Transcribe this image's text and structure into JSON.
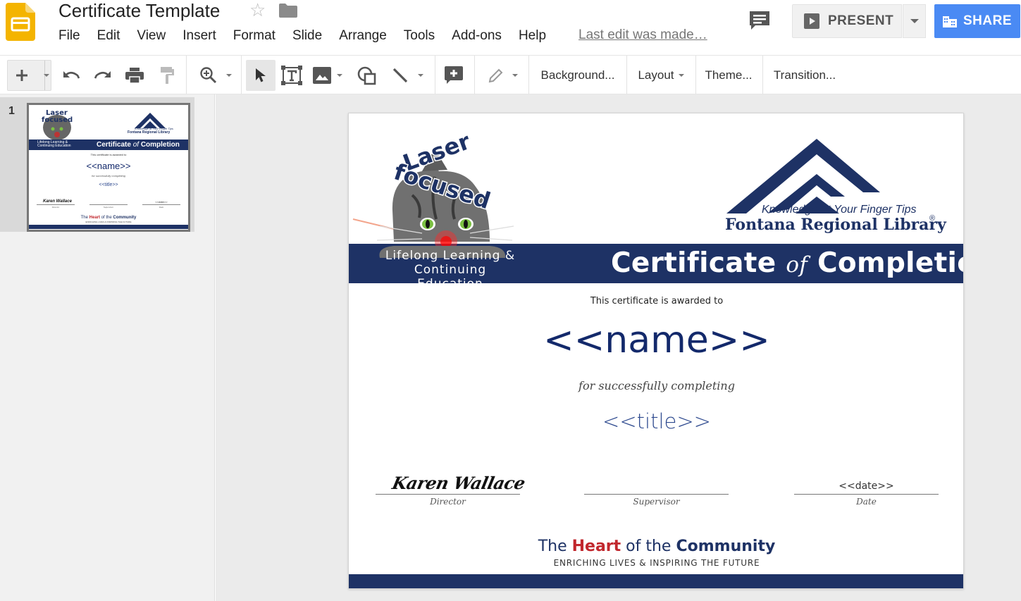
{
  "app": {
    "doc_title": "Certificate Template",
    "menu": [
      "File",
      "Edit",
      "View",
      "Insert",
      "Format",
      "Slide",
      "Arrange",
      "Tools",
      "Add-ons",
      "Help"
    ],
    "last_edit": "Last edit was made…",
    "present_label": "PRESENT",
    "share_label": "SHARE",
    "colors": {
      "share_blue": "#4a8af4",
      "logo_yellow": "#f4b400",
      "navy": "#1e3265"
    }
  },
  "toolbar": {
    "icons": [
      "new-slide-icon",
      "undo-icon",
      "redo-icon",
      "print-icon",
      "paint-format-icon",
      "zoom-icon",
      "select-icon",
      "textbox-icon",
      "image-icon",
      "shape-icon",
      "line-icon",
      "add-comment-icon",
      "pencil-icon"
    ],
    "background": "Background...",
    "layout": "Layout",
    "theme": "Theme...",
    "transition": "Transition..."
  },
  "filmstrip": {
    "slides": [
      {
        "number": "1",
        "thumb": {
          "laser": "Laser",
          "focused": "focused",
          "lib_tag": "Knowledge At Your Finger Tips",
          "lib_name": "Fontana Regional Library",
          "lifelong_1": "Lifelong Learning &",
          "lifelong_2": "Continuing Education",
          "cert_main": "Certificate",
          "cert_of": "of",
          "cert_tail": "Completion",
          "awarded": "This certificate is awarded to",
          "name": "<<name>>",
          "succ": "for successfully completing",
          "title": "<<title>>",
          "sig": "Karen Wallace",
          "date": "<<date>>",
          "sig_labels": [
            "Director",
            "Supervisor",
            "Date"
          ],
          "heart_pre": "The",
          "heart_red": "Heart",
          "heart_mid": "of the",
          "heart_bold": "Community",
          "enriching": "ENRICHING LIVES & INSPIRING THE FUTURE"
        }
      }
    ]
  },
  "slide": {
    "laser": "Laser",
    "focused": "focused",
    "lifelong_1": "Lifelong Learning &",
    "lifelong_2": "Continuing Education",
    "library_tagline": "Knowledge At Your Finger Tips",
    "library_name": "Fontana Regional Library",
    "registered": "®",
    "cert_main": "Certificate",
    "cert_of": "of",
    "cert_tail": "Completion",
    "awarded": "This certificate is awarded to",
    "name_placeholder": "<<name>>",
    "succ": "for successfully completing",
    "title_placeholder": "<<title>>",
    "signature": "Karen Wallace",
    "director_label": "Director",
    "supervisor_label": "Supervisor",
    "date_placeholder": "<<date>>",
    "date_label": "Date",
    "heart_pre": "The",
    "heart_red": "Heart",
    "heart_mid": "of the",
    "heart_bold": "Community",
    "enriching": "ENRICHING LIVES & INSPIRING THE FUTURE"
  }
}
